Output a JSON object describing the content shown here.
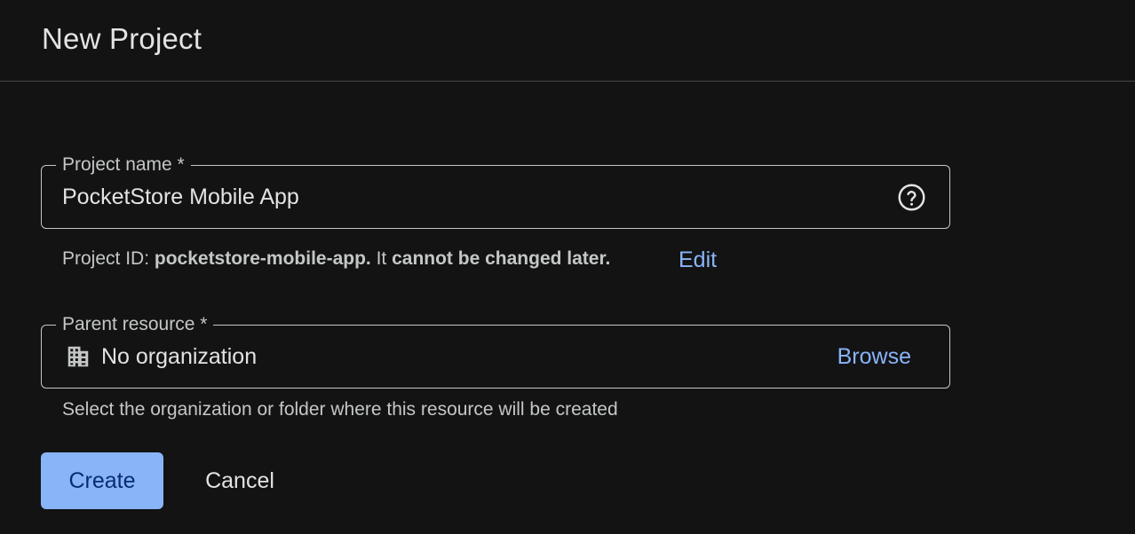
{
  "header": {
    "title": "New Project"
  },
  "project_name_field": {
    "label": "Project name *",
    "value": "PocketStore Mobile App",
    "help_icon": "help-circle-icon"
  },
  "project_id_hint": {
    "prefix": "Project ID: ",
    "project_id": "pocketstore-mobile-app.",
    "middle": " It ",
    "emphasis": "cannot be changed later.",
    "edit_label": "Edit"
  },
  "parent_resource_field": {
    "label": "Parent resource *",
    "icon": "organization-building-icon",
    "value": "No organization",
    "browse_label": "Browse",
    "hint": "Select the organization or folder where this resource will be created"
  },
  "actions": {
    "create_label": "Create",
    "cancel_label": "Cancel"
  },
  "colors": {
    "background": "#131314",
    "accent": "#8ab4f8",
    "border": "#c4c7c5",
    "text": "#e3e3e3"
  }
}
